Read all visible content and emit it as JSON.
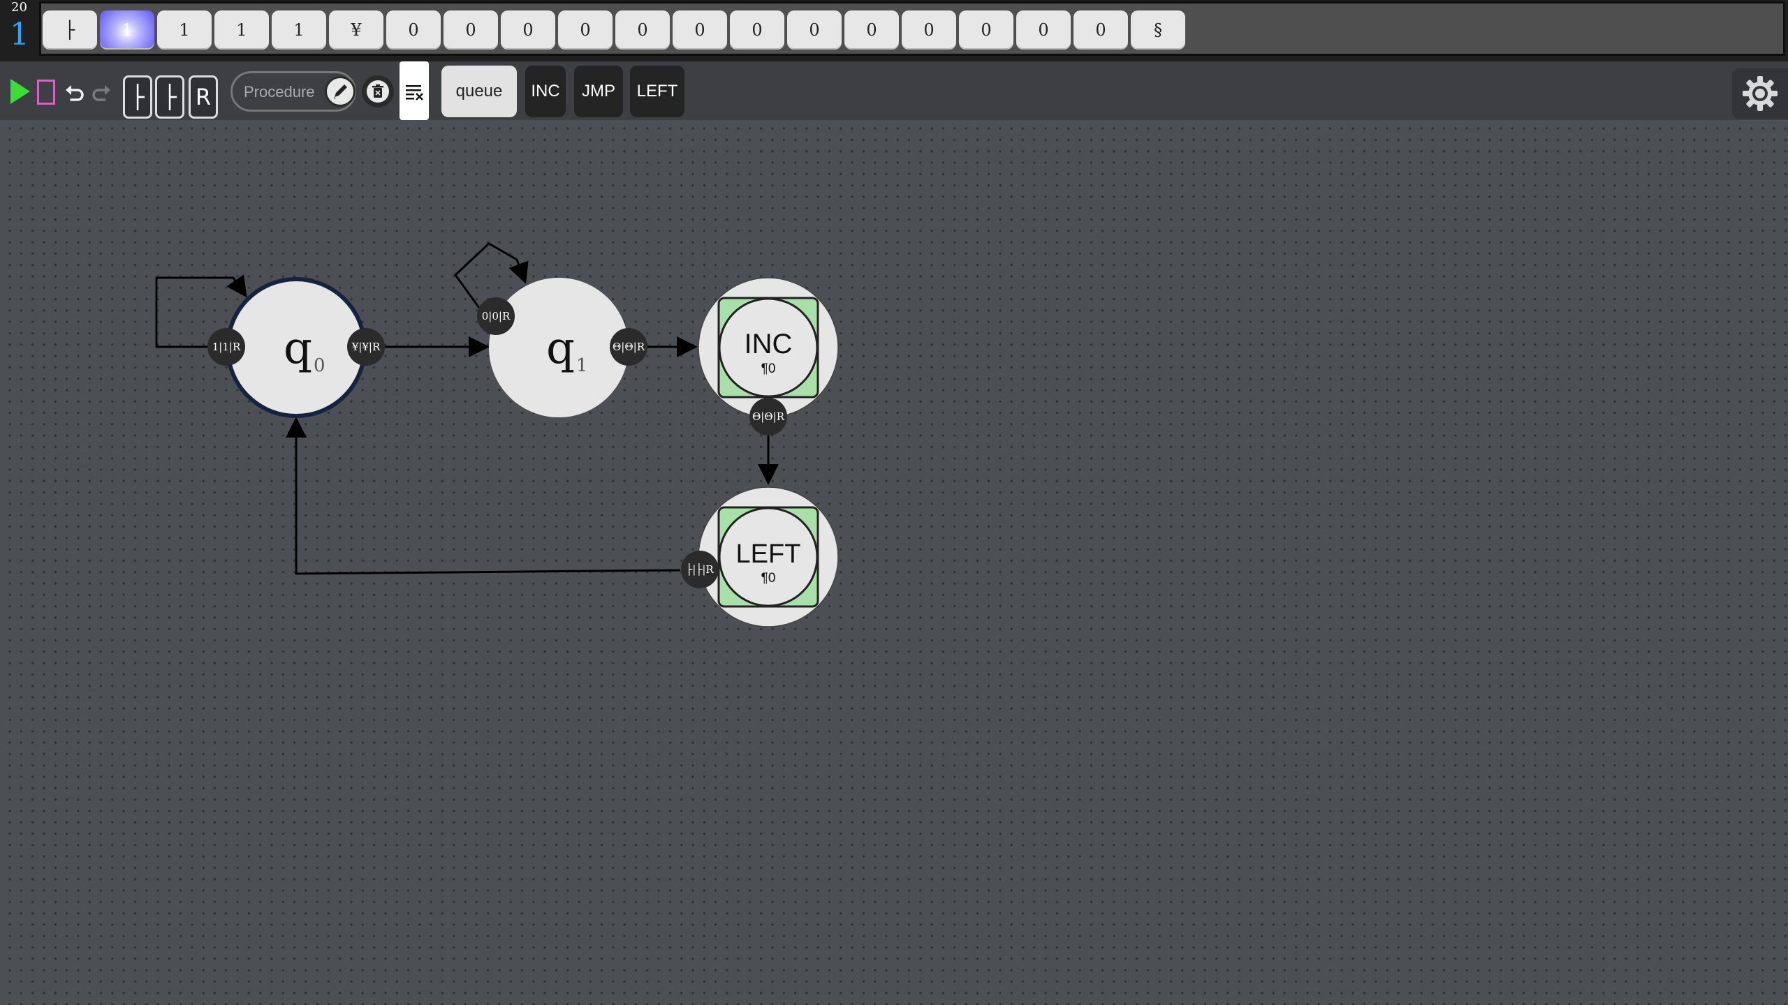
{
  "tape": {
    "step_count": "20",
    "head_position": "1",
    "cells": [
      "├",
      "1",
      "1",
      "1",
      "1",
      "¥",
      "0",
      "0",
      "0",
      "0",
      "0",
      "0",
      "0",
      "0",
      "0",
      "0",
      "0",
      "0",
      "0",
      "§"
    ],
    "active_index": 1
  },
  "toolbar": {
    "start_mark_a": "├",
    "start_mark_b": "├",
    "r_label": "R",
    "procedure_placeholder": "Procedure",
    "library": [
      "queue",
      "INC",
      "JMP",
      "LEFT"
    ],
    "icons": {
      "play": "play-icon",
      "stop": "stop-icon",
      "undo": "undo-icon",
      "redo": "redo-icon",
      "edit": "pencil-icon",
      "delete": "trash-icon",
      "clear": "clear-text-icon",
      "settings": "gear-icon"
    }
  },
  "graph": {
    "states": [
      {
        "name": "q",
        "sub": "0",
        "initial": true
      },
      {
        "name": "q",
        "sub": "1",
        "initial": false
      }
    ],
    "procedures": [
      {
        "name": "INC",
        "sub": "¶0"
      },
      {
        "name": "LEFT",
        "sub": "¶0"
      }
    ],
    "transitions": [
      {
        "from": "q0",
        "to": "q0",
        "label": "1|1|R"
      },
      {
        "from": "q0",
        "to": "q1",
        "label": "¥|¥|R"
      },
      {
        "from": "q1",
        "to": "q1",
        "label": "0|0|R"
      },
      {
        "from": "q1",
        "to": "INC",
        "label": "Θ|Θ|R"
      },
      {
        "from": "INC",
        "to": "LEFT",
        "label": "Θ|Θ|R"
      },
      {
        "from": "LEFT",
        "to": "q0",
        "label": "├|├|R"
      }
    ]
  },
  "colors": {
    "active_cell": "#5b55f0",
    "play": "#3ddc3d",
    "stop": "#e05ad0",
    "head_counter": "#2ea6ff",
    "initial_ring": "#16233f",
    "procedure_fill": "#a9dfa9"
  }
}
